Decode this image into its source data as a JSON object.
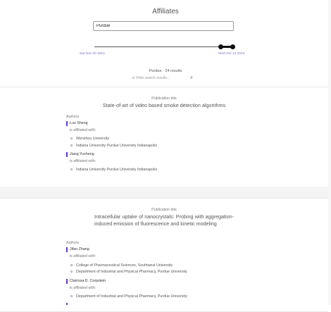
{
  "page": {
    "title": "Affiliates"
  },
  "search": {
    "value": "Purdue"
  },
  "date_range": {
    "start_label": "Sat Nov 20 1915",
    "end_label": "Wed Oct 12 2022"
  },
  "results": {
    "summary": "Purdue - 24 results",
    "filter_placeholder": "Filter search results..."
  },
  "labels": {
    "publication_title": "Publication title",
    "authors": "Authors",
    "affiliated_with": "is affiliated with:"
  },
  "publications": [
    {
      "title": "State-of-art of video based smoke detection algorithms",
      "authors": [
        {
          "name": "Luo Sheng",
          "affiliations": [
            "Wenzhou University",
            "Indiana University Purdue University Indianapolis"
          ]
        },
        {
          "name": "Jiang Yuzheng",
          "affiliations": [
            "Indiana University Purdue University Indianapolis"
          ]
        }
      ]
    },
    {
      "title": "Intracellular uptake of nanocrystals: Probing with aggregation-induced emission of fluorescence and kinetic modeling",
      "authors": [
        {
          "name": "Jifan Zhang",
          "affiliations": [
            "College of Pharmaceutical Sciences, Southwest University",
            "Department of Industrial and Physical Pharmacy, Purdue University"
          ]
        },
        {
          "name": "Clairissa D. Corpstein",
          "affiliations": [
            "Department of Industrial and Physical Pharmacy, Purdue University"
          ]
        }
      ]
    }
  ]
}
